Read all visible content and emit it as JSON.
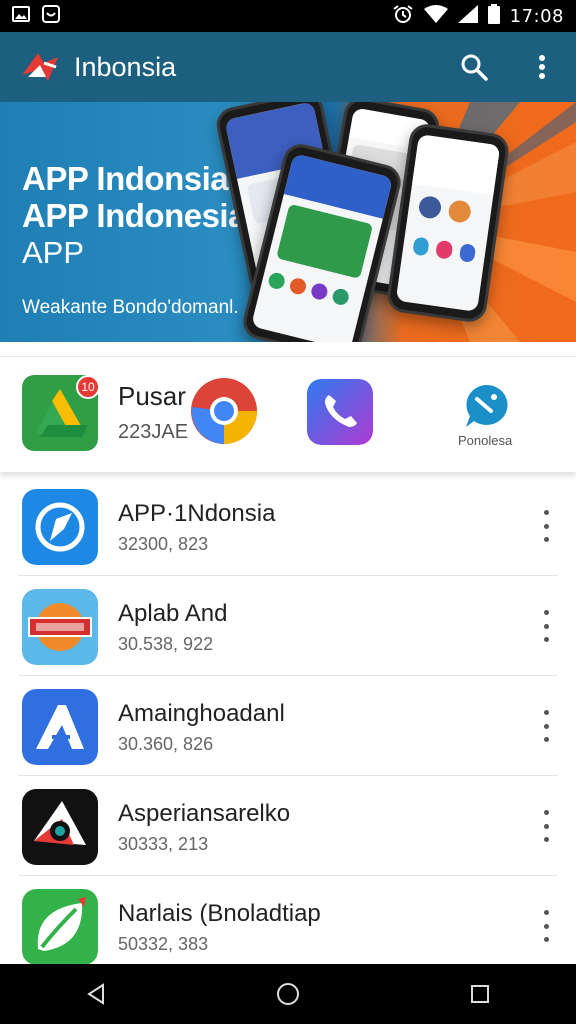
{
  "status_bar": {
    "time": "17:08",
    "left_icons": [
      "image-icon",
      "message-icon"
    ],
    "right_icons": [
      "alarm-icon",
      "wifi-icon",
      "signal-icon",
      "battery-icon"
    ]
  },
  "app_bar": {
    "title": "Inbonsia",
    "actions": [
      "search-icon",
      "overflow-menu-icon"
    ],
    "brand_color": "#1d5f7e"
  },
  "banner": {
    "line1": "APP Indonsia",
    "line2": "APP Indonesia",
    "line3": "APP",
    "subtitle": "Weakante Bondo'domanl."
  },
  "featured": {
    "title": "Pusar",
    "subtitle": "223JAE",
    "badge_count": "10",
    "last_label": "Ponolesa",
    "icons": [
      "drive-icon",
      "chrome-icon",
      "phone-icon",
      "chat-icon"
    ]
  },
  "apps": [
    {
      "name": "APP·1Ndonsia",
      "meta": "32300, 823",
      "icon": "messenger-icon"
    },
    {
      "name": "Aplab And",
      "meta": "30.538, 922",
      "icon": "badge-logo-icon"
    },
    {
      "name": "Amainghoadanl",
      "meta": "30.360, 826",
      "icon": "arrow-a-icon"
    },
    {
      "name": "Asperiansarelko",
      "meta": "30333, 213",
      "icon": "eye-triangle-icon"
    },
    {
      "name": "Narlais (Bnoladtiap",
      "meta": "50332, 383",
      "icon": "leaf-icon"
    }
  ],
  "nav_bar": {
    "buttons": [
      "back-icon",
      "home-icon",
      "recents-icon"
    ]
  }
}
